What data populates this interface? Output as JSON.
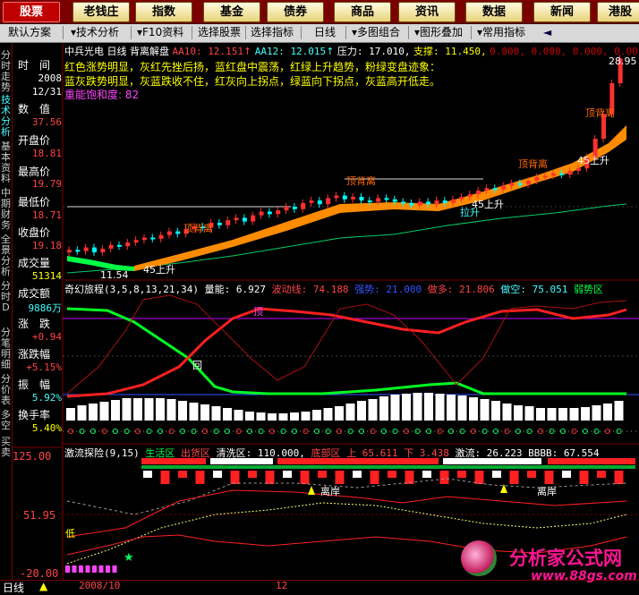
{
  "nav_tabs": [
    "股票",
    "老钱庄",
    "指数",
    "基金",
    "债券",
    "商品",
    "资讯",
    "数据",
    "新闻",
    "港股"
  ],
  "toolbar": [
    "默认方案",
    "技术分析",
    "F10资料",
    "选择股票",
    "选择指标",
    "日线",
    "多图组合",
    "图形叠加",
    "常用指标"
  ],
  "left_strip": [
    "分时走势",
    "技术分析",
    "基本资料",
    "中期财务",
    "全景分析",
    "分时D",
    "分笔明细",
    "分价表",
    "多空",
    "买卖"
  ],
  "info": {
    "time_label": "时　间",
    "time_year": "2008",
    "time_date": "12/31",
    "value_label": "数　值",
    "open_label": "开盘价",
    "open": "18.81",
    "high_label": "最高价",
    "high": "19.79",
    "low_label": "最低价",
    "low": "18.71",
    "close_label": "收盘价",
    "close": "19.18",
    "volume_label": "成交量",
    "volume": "51314",
    "amount_label": "成交额",
    "amount": "9886万",
    "change_label": "涨　跌",
    "change": "+0.94",
    "pct_label": "涨跌幅",
    "pct": "+5.15%",
    "amp_label": "振　幅",
    "amp": "5.92%",
    "turnover_label": "换手率",
    "turnover": "5.40%",
    "side_value": "37.56"
  },
  "main_chart": {
    "header": {
      "name": "中兵光电",
      "period": "日线",
      "indicator": "背离解盘",
      "aa10": "AA10: 12.151",
      "aa12": "AA12: 12.015",
      "pressure": "压力: 17.010,",
      "support": "支撑: 11.450,",
      "zeros": "0.000, 0.000, 0.000, 0.00"
    },
    "legend_line1": "红色涨势明显，灰红先挫后扬，蓝红盘中震荡，红绿上升趋势，粉绿变盘迹象：",
    "legend_line2": "蓝灰跌势明显，灰蓝跌收不住，红灰向上拐点，绿蓝向下拐点，灰蓝高开低走。",
    "saturation": "重能饱和度: 82",
    "top_price": "28.95",
    "low_price": "11.54",
    "annotations": [
      "顶背离",
      "顶背离",
      "顶背离",
      "顶背离",
      "45上升",
      "45上升",
      "45上升",
      "45上升",
      "拉升"
    ],
    "candles": [
      13.0,
      12.9,
      13.2,
      12.8,
      13.1,
      13.4,
      13.3,
      13.6,
      13.8,
      14.0,
      13.9,
      14.2,
      14.5,
      14.3,
      14.7,
      14.9,
      14.8,
      15.2,
      15.0,
      15.4,
      15.6,
      15.3,
      15.8,
      16.1,
      15.9,
      16.2,
      16.5,
      16.3,
      16.8,
      17.0,
      16.7,
      17.2,
      17.4,
      17.1,
      17.3,
      17.0,
      16.9,
      17.2,
      17.1,
      16.9,
      16.8,
      16.6,
      16.9,
      16.7,
      17.0,
      16.8,
      17.1,
      17.3,
      17.5,
      17.8,
      18.0,
      17.9,
      18.2,
      18.4,
      18.3,
      18.6,
      18.9,
      19.0,
      19.2,
      19.1,
      19.4,
      19.6,
      20.5,
      22.0,
      24.0,
      26.5,
      28.5
    ]
  },
  "osc_chart": {
    "header": "奇幻旅程(3,5,8,13,21,34)",
    "energy": "量能: 6.927",
    "wave": "波动线: 74.188",
    "strong": "强势: 21.000",
    "long": "做多: 21.806",
    "short": "做空: 75.051",
    "weak": "弱势区",
    "labels": [
      "顶",
      "回"
    ]
  },
  "flow_chart": {
    "header": "激流探险(9,15)",
    "life": "生活区",
    "out": "出货区",
    "clear": "清洗区: 110.000,",
    "bottom": "底部区",
    "up": "上 65.611",
    "down": "下 3.438",
    "flow": "激流: 26.223",
    "bbbb": "BBBB: 67.554",
    "y_top": "125.00",
    "y_mid": "51.95",
    "y_bot": "-20.00",
    "labels": [
      "离岸",
      "离岸",
      "低"
    ]
  },
  "bottom": {
    "period": "日线",
    "date": "2008/10",
    "month": "12"
  },
  "watermark": {
    "title": "分析家公式网",
    "url": "www.88gs.com"
  },
  "colors": {
    "up": "#ff3030",
    "down": "#00ffff",
    "bg": "#000000",
    "accent": "#ffff00",
    "orange": "#ff8c00"
  }
}
